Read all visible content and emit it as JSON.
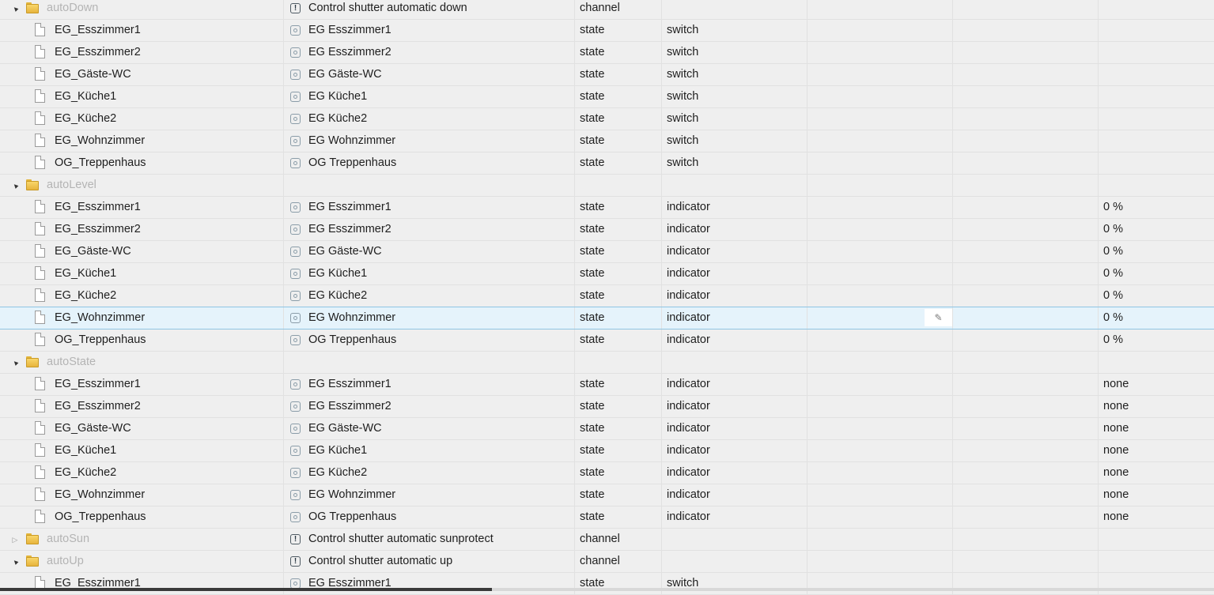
{
  "rows": [
    {
      "kind": "folder",
      "expanded": true,
      "name": "autoDown",
      "title": "Control shutter automatic down",
      "title_icon": "channel-icon",
      "type": "channel",
      "role": "",
      "room": "",
      "func": "",
      "value": ""
    },
    {
      "kind": "state",
      "name": "EG_Esszimmer1",
      "title": "EG Esszimmer1",
      "title_icon": "state-icon",
      "type": "state",
      "role": "switch",
      "room": "",
      "func": "",
      "value": ""
    },
    {
      "kind": "state",
      "name": "EG_Esszimmer2",
      "title": "EG Esszimmer2",
      "title_icon": "state-icon",
      "type": "state",
      "role": "switch",
      "room": "",
      "func": "",
      "value": ""
    },
    {
      "kind": "state",
      "name": "EG_Gäste-WC",
      "title": "EG Gäste-WC",
      "title_icon": "state-icon",
      "type": "state",
      "role": "switch",
      "room": "",
      "func": "",
      "value": ""
    },
    {
      "kind": "state",
      "name": "EG_Küche1",
      "title": "EG Küche1",
      "title_icon": "state-icon",
      "type": "state",
      "role": "switch",
      "room": "",
      "func": "",
      "value": ""
    },
    {
      "kind": "state",
      "name": "EG_Küche2",
      "title": "EG Küche2",
      "title_icon": "state-icon",
      "type": "state",
      "role": "switch",
      "room": "",
      "func": "",
      "value": ""
    },
    {
      "kind": "state",
      "name": "EG_Wohnzimmer",
      "title": "EG Wohnzimmer",
      "title_icon": "state-icon",
      "type": "state",
      "role": "switch",
      "room": "",
      "func": "",
      "value": ""
    },
    {
      "kind": "state",
      "name": "OG_Treppenhaus",
      "title": "OG Treppenhaus",
      "title_icon": "state-icon",
      "type": "state",
      "role": "switch",
      "room": "",
      "func": "",
      "value": ""
    },
    {
      "kind": "folder",
      "expanded": true,
      "name": "autoLevel",
      "title": "",
      "title_icon": "",
      "type": "",
      "role": "",
      "room": "",
      "func": "",
      "value": ""
    },
    {
      "kind": "state",
      "name": "EG_Esszimmer1",
      "title": "EG Esszimmer1",
      "title_icon": "state-icon",
      "type": "state",
      "role": "indicator",
      "room": "",
      "func": "",
      "value": "0 %"
    },
    {
      "kind": "state",
      "name": "EG_Esszimmer2",
      "title": "EG Esszimmer2",
      "title_icon": "state-icon",
      "type": "state",
      "role": "indicator",
      "room": "",
      "func": "",
      "value": "0 %"
    },
    {
      "kind": "state",
      "name": "EG_Gäste-WC",
      "title": "EG Gäste-WC",
      "title_icon": "state-icon",
      "type": "state",
      "role": "indicator",
      "room": "",
      "func": "",
      "value": "0 %"
    },
    {
      "kind": "state",
      "name": "EG_Küche1",
      "title": "EG Küche1",
      "title_icon": "state-icon",
      "type": "state",
      "role": "indicator",
      "room": "",
      "func": "",
      "value": "0 %"
    },
    {
      "kind": "state",
      "name": "EG_Küche2",
      "title": "EG Küche2",
      "title_icon": "state-icon",
      "type": "state",
      "role": "indicator",
      "room": "",
      "func": "",
      "value": "0 %"
    },
    {
      "kind": "state",
      "selected": true,
      "edit_icon": "pencil-icon",
      "name": "EG_Wohnzimmer",
      "title": "EG Wohnzimmer",
      "title_icon": "state-icon",
      "type": "state",
      "role": "indicator",
      "room": "",
      "func": "",
      "value": "0 %"
    },
    {
      "kind": "state",
      "name": "OG_Treppenhaus",
      "title": "OG Treppenhaus",
      "title_icon": "state-icon",
      "type": "state",
      "role": "indicator",
      "room": "",
      "func": "",
      "value": "0 %"
    },
    {
      "kind": "folder",
      "expanded": true,
      "name": "autoState",
      "title": "",
      "title_icon": "",
      "type": "",
      "role": "",
      "room": "",
      "func": "",
      "value": ""
    },
    {
      "kind": "state",
      "name": "EG_Esszimmer1",
      "title": "EG Esszimmer1",
      "title_icon": "state-icon",
      "type": "state",
      "role": "indicator",
      "room": "",
      "func": "",
      "value": "none"
    },
    {
      "kind": "state",
      "name": "EG_Esszimmer2",
      "title": "EG Esszimmer2",
      "title_icon": "state-icon",
      "type": "state",
      "role": "indicator",
      "room": "",
      "func": "",
      "value": "none"
    },
    {
      "kind": "state",
      "name": "EG_Gäste-WC",
      "title": "EG Gäste-WC",
      "title_icon": "state-icon",
      "type": "state",
      "role": "indicator",
      "room": "",
      "func": "",
      "value": "none"
    },
    {
      "kind": "state",
      "name": "EG_Küche1",
      "title": "EG Küche1",
      "title_icon": "state-icon",
      "type": "state",
      "role": "indicator",
      "room": "",
      "func": "",
      "value": "none"
    },
    {
      "kind": "state",
      "name": "EG_Küche2",
      "title": "EG Küche2",
      "title_icon": "state-icon",
      "type": "state",
      "role": "indicator",
      "room": "",
      "func": "",
      "value": "none"
    },
    {
      "kind": "state",
      "name": "EG_Wohnzimmer",
      "title": "EG Wohnzimmer",
      "title_icon": "state-icon",
      "type": "state",
      "role": "indicator",
      "room": "",
      "func": "",
      "value": "none"
    },
    {
      "kind": "state",
      "name": "OG_Treppenhaus",
      "title": "OG Treppenhaus",
      "title_icon": "state-icon",
      "type": "state",
      "role": "indicator",
      "room": "",
      "func": "",
      "value": "none"
    },
    {
      "kind": "folder",
      "expanded": false,
      "name": "autoSun",
      "title": "Control shutter automatic sunprotect",
      "title_icon": "channel-icon",
      "type": "channel",
      "role": "",
      "room": "",
      "func": "",
      "value": ""
    },
    {
      "kind": "folder",
      "expanded": true,
      "name": "autoUp",
      "title": "Control shutter automatic up",
      "title_icon": "channel-icon",
      "type": "channel",
      "role": "",
      "room": "",
      "func": "",
      "value": ""
    },
    {
      "kind": "state",
      "name": "EG_Esszimmer1",
      "title": "EG Esszimmer1",
      "title_icon": "state-icon",
      "type": "state",
      "role": "switch",
      "room": "",
      "func": "",
      "value": ""
    }
  ],
  "icons": {
    "expanded": "▲",
    "collapsed": "▷",
    "channel_glyph": "!",
    "edit_glyph": "✎"
  },
  "colors": {
    "selection_bg": "#e5f3fb",
    "selection_border": "#8fc5e3",
    "folder_label": "#b4b4b4"
  },
  "scrollbar": {
    "visible_fraction": 0.405
  }
}
